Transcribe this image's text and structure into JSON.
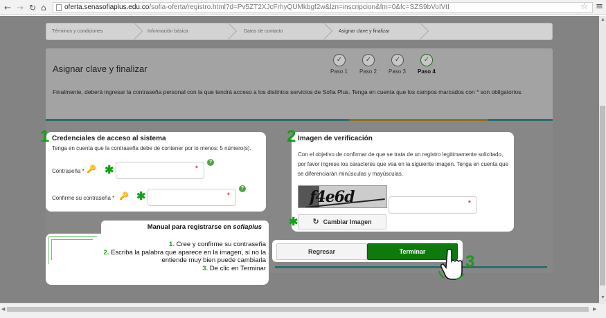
{
  "browser": {
    "url_domain": "oferta.senasofiaplus.edu.co",
    "url_path": "/sofia-oferta/registro.html?d=Pv5ZT2XJcFrhyQUMkbgf2w&lzn=inscripcion&fm=0&fc=SZS9bVoIVtI"
  },
  "wizard": {
    "steps": [
      {
        "label": "Términos y condiciones"
      },
      {
        "label": "Información básica"
      },
      {
        "label": "Datos de contacto"
      },
      {
        "label": "Asignar clave y finalizar"
      }
    ]
  },
  "page": {
    "title": "Asignar clave y finalizar",
    "description": "Finalmente, deberá ingresar la contraseña personal con la que tendrá acceso a los distintos servicios de Sofia Plus. Tenga en cuenta que los campos marcados con * son obligatorios.",
    "progress": [
      {
        "label": "Paso 1",
        "done": true
      },
      {
        "label": "Paso 2",
        "done": true
      },
      {
        "label": "Paso 3",
        "done": true
      },
      {
        "label": "Paso 4",
        "done": true,
        "current": true
      }
    ]
  },
  "credentials": {
    "number": "1",
    "title": "Credenciales de acceso al sistema",
    "hint": "Tenga en cuenta que la contraseña debe de contener por lo menos: 5 número(s).",
    "password_label": "Contraseña *",
    "confirm_label": "Confirme su contraseña *",
    "password_value": "",
    "confirm_value": "",
    "required_mark": "*"
  },
  "verification": {
    "number": "2",
    "title": "Imagen de verificación",
    "text": "Con el objetivo de confirmar de que se trata de un registro legitimamente solicitado, por favor ingrese los caracteres que vea en la siguiente imagen. Tenga en cuenta que se diferenciarán minúsculas y mayúsculas.",
    "captcha_text": "f4e6d",
    "input_value": "",
    "change_image_label": "Cambiar Imagen",
    "required_mark": "*"
  },
  "actions": {
    "back_label": "Regresar",
    "finish_label": "Terminar",
    "number": "3"
  },
  "manual": {
    "title_prefix": "Manual para registrarse en ",
    "title_italic": "sofiaplus",
    "steps": [
      {
        "num": "1.",
        "text": " Cree y confirme su contraseña"
      },
      {
        "num": "2.",
        "text": " Escriba la palabra que aparece en la imagen, si no la"
      },
      {
        "num": "",
        "text": "entiende muy bien puede cambiarla"
      },
      {
        "num": "3.",
        "text": " De clic en Terminar"
      }
    ]
  },
  "colors": {
    "accent_green": "#14a014",
    "finish_button": "#0e7a0e",
    "teal_line": "#2d6d6d"
  }
}
